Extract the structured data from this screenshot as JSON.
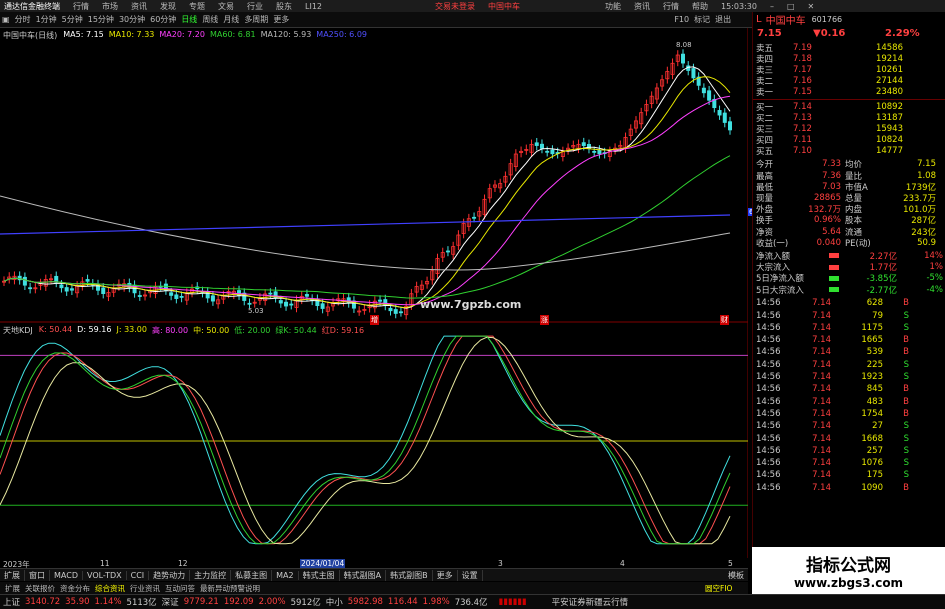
{
  "titlebar": {
    "items": [
      "通达信金融终端",
      "行情",
      "市场",
      "资讯",
      "发现",
      "专题",
      "文易",
      "行业",
      "股东",
      "LI12"
    ],
    "alert": "交易未登录",
    "center_title": "中国中车",
    "right_items": [
      "功能",
      "资讯",
      "行情",
      "帮助"
    ],
    "time": "15:03:30"
  },
  "toolbar": {
    "periods": [
      "分时",
      "1分钟",
      "5分钟",
      "15分钟",
      "30分钟",
      "60分钟",
      "日线",
      "周线",
      "月线",
      "多周期",
      "更多"
    ],
    "right": [
      "F10",
      "标记",
      "退出"
    ]
  },
  "main": {
    "stock_label": "中国中车(日线)",
    "ma_items": [
      {
        "label": "MA5: 7.15",
        "color": "#ffffff"
      },
      {
        "label": "MA10: 7.33",
        "color": "#e8e800"
      },
      {
        "label": "MA20: 7.20",
        "color": "#ff40ff"
      },
      {
        "label": "MA60: 6.81",
        "color": "#30d030"
      },
      {
        "label": "MA120: 5.93",
        "color": "#bbbbbb"
      },
      {
        "label": "MA250: 6.09",
        "color": "#5050ff"
      }
    ],
    "price_high": "8.08",
    "price_low": "5.03",
    "watermark": "www.7gpzb.com",
    "current_tag": "6.09",
    "price_axis": [
      "8.00",
      "7.75",
      "7.50",
      "7.25",
      "7.00",
      "6.75",
      "6.50",
      "6.25",
      "6.00",
      "5.75",
      "5.50",
      "5.25"
    ],
    "markers": [
      "增",
      "涨",
      "财"
    ]
  },
  "kdj": {
    "name": "天地KDJ",
    "items": [
      {
        "label": "K: 50.44",
        "color": "#ff5050"
      },
      {
        "label": "D: 59.16",
        "color": "#ffffff"
      },
      {
        "label": "J: 33.00",
        "color": "#e8e800"
      },
      {
        "label": "高: 80.00",
        "color": "#ff40ff"
      },
      {
        "label": "中: 50.00",
        "color": "#e8e800"
      },
      {
        "label": "低: 20.00",
        "color": "#30d030"
      },
      {
        "label": "绿K: 50.44",
        "color": "#30d030"
      },
      {
        "label": "红D: 59.16",
        "color": "#ff5050"
      }
    ],
    "axis": [
      "100.00",
      "90.00",
      "80.00",
      "70.00",
      "60.00",
      "50.00",
      "40.00",
      "30.00",
      "20.00",
      "10.00"
    ],
    "lines": {
      "high": 90,
      "mid": 50,
      "low": 20
    }
  },
  "date_axis": {
    "items": [
      "2023年",
      "11",
      "12",
      "2024/01/04",
      "3",
      "4",
      "5"
    ]
  },
  "tabs": [
    "扩展",
    "窗口",
    "MACD",
    "VOL-TDX",
    "CCI",
    "趋势动力",
    "主力监控",
    "私募主图",
    "MA2",
    "韩式主图",
    "韩式副图A",
    "韩式副图B",
    "更多",
    "设置"
  ],
  "quote": {
    "name": "中国中车",
    "code": "601766",
    "price": "7.15",
    "change": "▼0.16",
    "pct": "2.29%",
    "sells": [
      {
        "label": "卖五",
        "price": "7.19",
        "vol": "14586"
      },
      {
        "label": "卖四",
        "price": "7.18",
        "vol": "19214"
      },
      {
        "label": "卖三",
        "price": "7.17",
        "vol": "10261"
      },
      {
        "label": "卖二",
        "price": "7.16",
        "vol": "27144"
      },
      {
        "label": "卖一",
        "price": "7.15",
        "vol": "23480"
      }
    ],
    "buys": [
      {
        "label": "买一",
        "price": "7.14",
        "vol": "10892"
      },
      {
        "label": "买二",
        "price": "7.13",
        "vol": "13187"
      },
      {
        "label": "买三",
        "price": "7.12",
        "vol": "15943"
      },
      {
        "label": "买四",
        "price": "7.11",
        "vol": "10824"
      },
      {
        "label": "买五",
        "price": "7.10",
        "vol": "14777"
      }
    ],
    "stats": [
      [
        "今开",
        "7.33",
        "均价",
        "7.15"
      ],
      [
        "最高",
        "7.36",
        "量比",
        "1.08"
      ],
      [
        "最低",
        "7.03",
        "市值A",
        "1739亿"
      ],
      [
        "现量",
        "28865",
        "总量",
        "233.7万"
      ],
      [
        "外盘",
        "132.7万",
        "内盘",
        "101.0万"
      ],
      [
        "换手",
        "0.96%",
        "股本",
        "287亿"
      ],
      [
        "净资",
        "5.64",
        "流通",
        "243亿"
      ],
      [
        "收益(一)",
        "0.040",
        "PE(动)",
        "50.9"
      ]
    ],
    "flows": [
      {
        "label": "净流入额",
        "val": "2.27亿",
        "pct": "14%",
        "color": "#ff4040",
        "bar": 1
      },
      {
        "label": "大宗流入",
        "val": "1.77亿",
        "pct": "1%",
        "color": "#ff4040",
        "bar": 1
      },
      {
        "label": "5日净流入额",
        "val": "-3.85亿",
        "pct": "-5%",
        "color": "#30e030",
        "bar": 2
      },
      {
        "label": "5日大宗流入",
        "val": "-2.77亿",
        "pct": "-4%",
        "color": "#30e030",
        "bar": 2
      }
    ]
  },
  "ticks": [
    [
      "14:56",
      "7.14",
      "628",
      "B"
    ],
    [
      "14:56",
      "7.14",
      "79",
      "S"
    ],
    [
      "14:56",
      "7.14",
      "1175",
      "S"
    ],
    [
      "14:56",
      "7.14",
      "1665",
      "B"
    ],
    [
      "14:56",
      "7.14",
      "539",
      "B"
    ],
    [
      "14:56",
      "7.14",
      "225",
      "S"
    ],
    [
      "14:56",
      "7.14",
      "1923",
      "S"
    ],
    [
      "14:56",
      "7.14",
      "845",
      "B"
    ],
    [
      "14:56",
      "7.14",
      "483",
      "B"
    ],
    [
      "14:56",
      "7.14",
      "1754",
      "B"
    ],
    [
      "14:56",
      "7.14",
      "27",
      "S"
    ],
    [
      "14:56",
      "7.14",
      "1668",
      "S"
    ],
    [
      "14:56",
      "7.14",
      "257",
      "S"
    ],
    [
      "14:56",
      "7.14",
      "1076",
      "S"
    ],
    [
      "14:56",
      "7.14",
      "175",
      "S"
    ],
    [
      "14:56",
      "7.14",
      "1090",
      "B"
    ]
  ],
  "rightfoot": {
    "label": "指标公式网",
    "url": "www.zbgs3.com"
  },
  "bottom_tab": "模板",
  "status": {
    "idx1": {
      "name": "上证",
      "val": "3140.72",
      "chg": "35.90",
      "pct": "1.14%",
      "amt": "5113亿"
    },
    "idx2": {
      "name": "深证",
      "val": "9779.21",
      "chg": "192.09",
      "pct": "2.00%",
      "amt": "5912亿"
    },
    "idx3": {
      "name": "中小",
      "val": "5982.98",
      "chg": "116.44",
      "pct": "1.98%",
      "amt": "736.4亿"
    },
    "right": "平安证券新疆云行情"
  },
  "subbar": [
    "扩展",
    "关联报价",
    "资金分布",
    "综合资讯",
    "行业资讯",
    "互动问答",
    "最新异动预警说明"
  ],
  "bottom_right": "圆空FIO"
}
